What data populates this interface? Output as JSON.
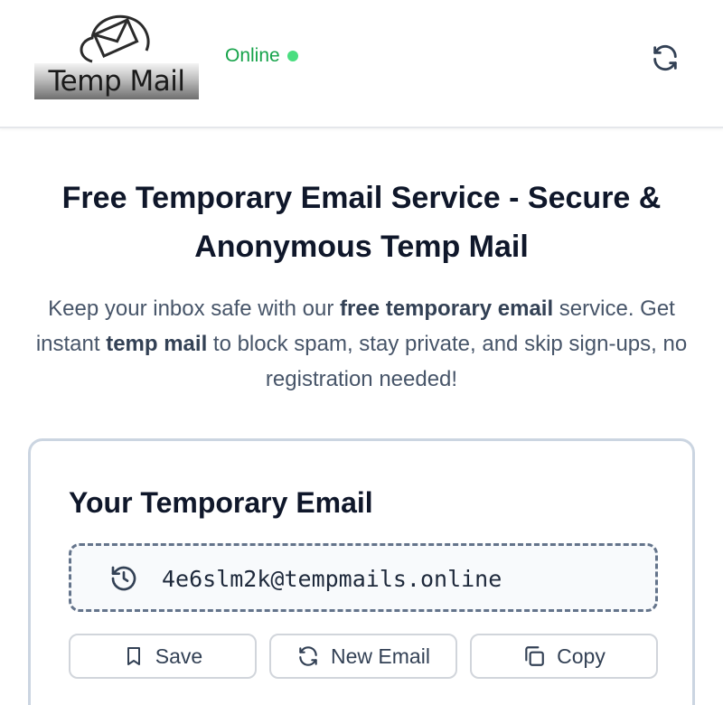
{
  "header": {
    "logo_text": "Temp Mail",
    "status_text": "Online",
    "status_color": "#16a34a",
    "status_dot_color": "#4ade80",
    "refresh_icon": "refresh-icon"
  },
  "hero": {
    "title": "Free Temporary Email Service - Secure & Anonymous Temp Mail",
    "subtitle_parts": {
      "p1": "Keep your inbox safe with our ",
      "b1": "free temporary email",
      "p2": " service. Get instant ",
      "b2": "temp mail",
      "p3": " to block spam, stay private, and skip sign-ups, no registration needed!"
    }
  },
  "card": {
    "title": "Your Temporary Email",
    "email": "4e6slm2k@tempmails.online",
    "history_icon": "history-icon",
    "buttons": {
      "save": "Save",
      "new_email": "New Email",
      "copy": "Copy"
    }
  }
}
